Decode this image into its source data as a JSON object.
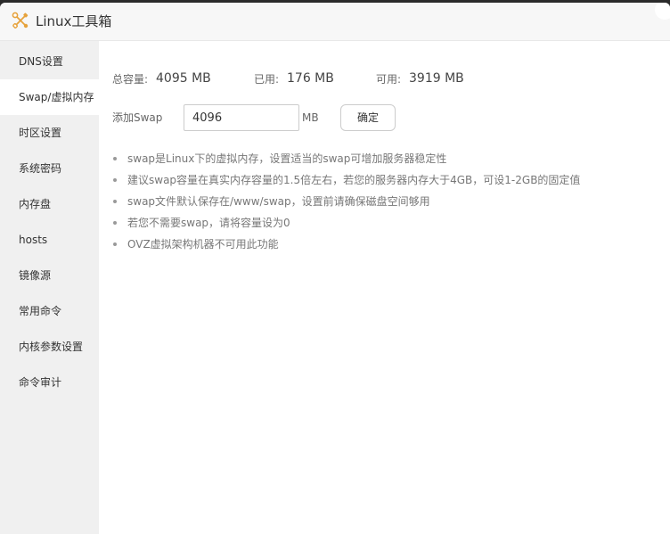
{
  "window": {
    "title": "Linux工具箱",
    "app_icon": "tools-icon",
    "close_icon": "close-icon"
  },
  "sidebar": {
    "items": [
      {
        "label": "DNS设置"
      },
      {
        "label": "Swap/虚拟内存",
        "active": true
      },
      {
        "label": "时区设置"
      },
      {
        "label": "系统密码"
      },
      {
        "label": "内存盘"
      },
      {
        "label": "hosts"
      },
      {
        "label": "镜像源"
      },
      {
        "label": "常用命令"
      },
      {
        "label": "内核参数设置"
      },
      {
        "label": "命令审计"
      }
    ]
  },
  "swap": {
    "total_label": "总容量:",
    "total_value": "4095 MB",
    "used_label": "已用:",
    "used_value": "176 MB",
    "free_label": "可用:",
    "free_value": "3919 MB",
    "add_label": "添加Swap",
    "input_value": "4096",
    "unit": "MB",
    "confirm_label": "确定"
  },
  "tips": [
    "swap是Linux下的虚拟内存，设置适当的swap可增加服务器稳定性",
    "建议swap容量在真实内存容量的1.5倍左右，若您的服务器内存大于4GB，可设1-2GB的固定值",
    "swap文件默认保存在/www/swap，设置前请确保磁盘空间够用",
    "若您不需要swap，请将容量设为0",
    "OVZ虚拟架构机器不可用此功能"
  ],
  "colors": {
    "sidebar_bg": "#f0f0f0",
    "active_item_bg": "#ffffff",
    "icon_accent": "#e6a23c"
  }
}
